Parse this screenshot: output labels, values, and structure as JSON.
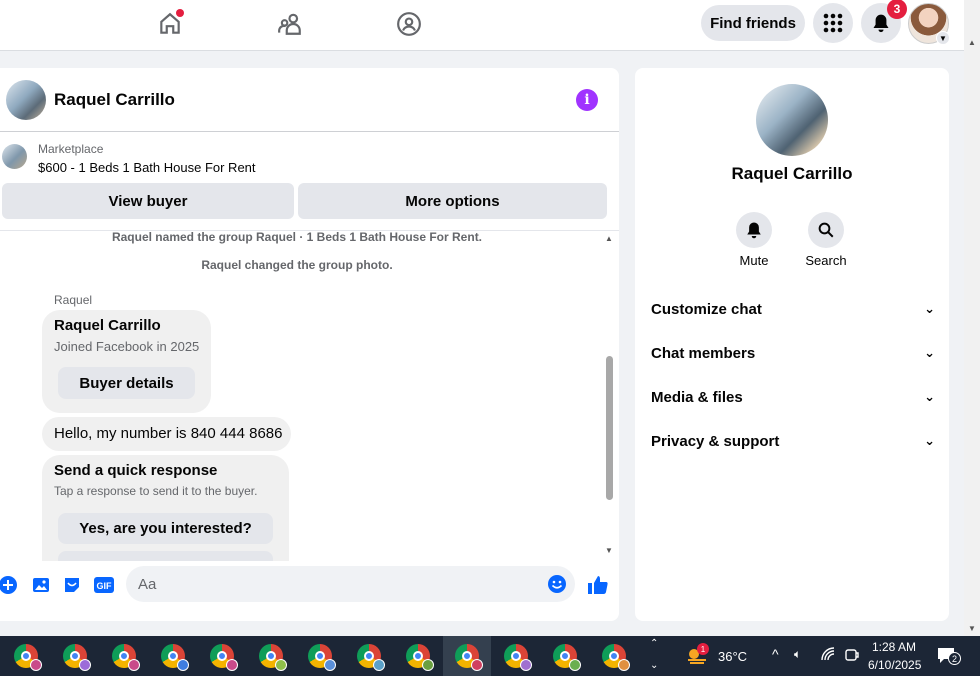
{
  "topnav": {
    "icons": [
      "home-icon",
      "friends-icon",
      "groups-icon"
    ],
    "find_friends": "Find friends",
    "notif_count": "3"
  },
  "chat": {
    "name": "Raquel Carrillo",
    "marketplace_label": "Marketplace",
    "listing_title": "$600 - 1 Beds 1 Bath House For Rent",
    "view_buyer": "View buyer",
    "more_options": "More options",
    "system_messages": [
      "Raquel named the group Raquel · 1 Beds 1 Bath House For Rent.",
      "Raquel changed the group photo."
    ],
    "sender": "Raquel",
    "card": {
      "name": "Raquel Carrillo",
      "sub": "Joined Facebook in 2025",
      "button": "Buyer details"
    },
    "message": "Hello, my number is 840 444 8686",
    "quick": {
      "title": "Send a quick response",
      "sub": "Tap a response to send it to the buyer.",
      "option1": "Yes, are you interested?"
    },
    "composer_placeholder": "Aa"
  },
  "info_panel": {
    "name": "Raquel Carrillo",
    "actions": [
      "Mute",
      "Search"
    ],
    "sections": [
      "Customize chat",
      "Chat members",
      "Media & files",
      "Privacy & support"
    ]
  },
  "taskbar": {
    "weather_temp": "36°C",
    "weather_badge": "1",
    "time": "1:28 AM",
    "date": "6/10/2025",
    "notif_count": "2",
    "profile_colors": [
      "#c94a8a",
      "#9c6cd9",
      "#c94a8a",
      "#3f7de0",
      "#c94a8a",
      "#8fbf4a",
      "#5a8fd9",
      "#5aa0c8",
      "#6a9f40",
      "#d04060",
      "#a070d0",
      "#6aaf50",
      "#e09040"
    ]
  },
  "colors": {
    "accent": "#0866ff",
    "purple": "#a033ff"
  }
}
